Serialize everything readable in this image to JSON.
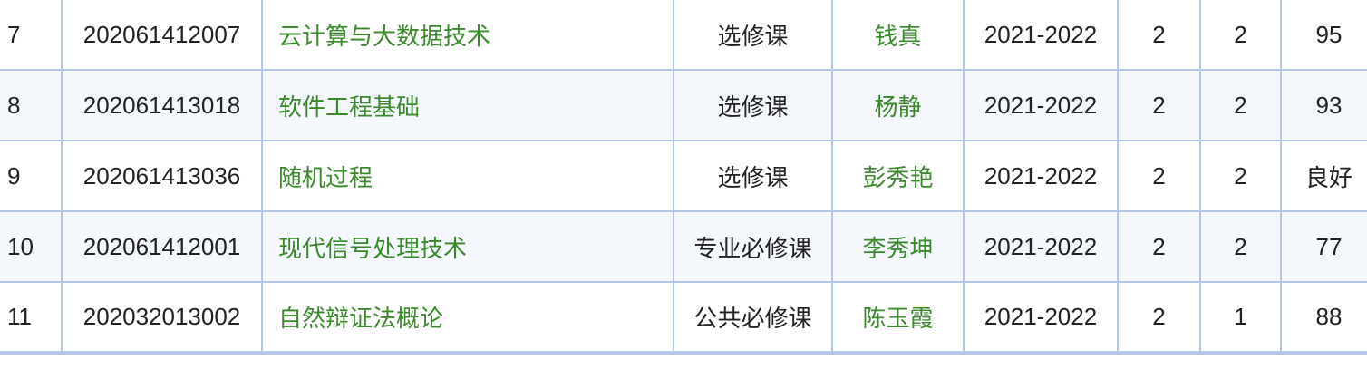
{
  "table": {
    "rows": [
      {
        "index": "7",
        "course_id": "202061412007",
        "course_name": "云计算与大数据技术",
        "course_type": "选修课",
        "teacher": "钱真",
        "year": "2021-2022",
        "col_a": "2",
        "col_b": "2",
        "score": "95"
      },
      {
        "index": "8",
        "course_id": "202061413018",
        "course_name": "软件工程基础",
        "course_type": "选修课",
        "teacher": "杨静",
        "year": "2021-2022",
        "col_a": "2",
        "col_b": "2",
        "score": "93"
      },
      {
        "index": "9",
        "course_id": "202061413036",
        "course_name": "随机过程",
        "course_type": "选修课",
        "teacher": "彭秀艳",
        "year": "2021-2022",
        "col_a": "2",
        "col_b": "2",
        "score": "良好"
      },
      {
        "index": "10",
        "course_id": "202061412001",
        "course_name": "现代信号处理技术",
        "course_type": "专业必修课",
        "teacher": "李秀坤",
        "year": "2021-2022",
        "col_a": "2",
        "col_b": "2",
        "score": "77"
      },
      {
        "index": "11",
        "course_id": "202032013002",
        "course_name": "自然辩证法概论",
        "course_type": "公共必修课",
        "teacher": "陈玉霞",
        "year": "2021-2022",
        "col_a": "2",
        "col_b": "1",
        "score": "88"
      }
    ]
  },
  "colors": {
    "link": "#3a8a2c",
    "border": "#b4c8e6",
    "alt_row": "#f4f7fc"
  }
}
